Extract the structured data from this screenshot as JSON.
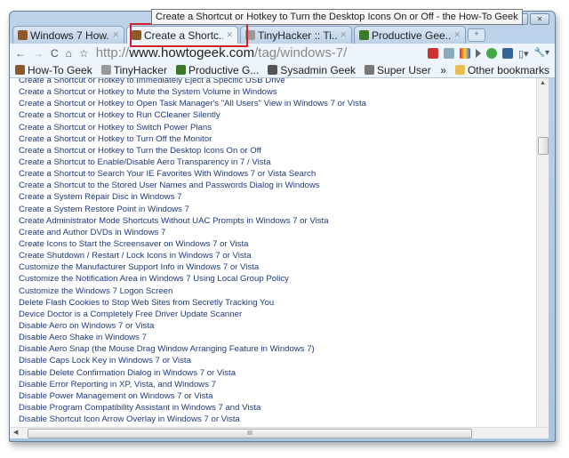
{
  "tooltip": "Create a Shortcut or Hotkey to Turn the Desktop Icons On or Off - the How-To Geek",
  "tabs": [
    {
      "label": "Windows 7 How...",
      "color": "#8a5a2a"
    },
    {
      "label": "Create a Shortc...",
      "color": "#8a5a2a"
    },
    {
      "label": "TinyHacker :: Ti...",
      "color": "#999999"
    },
    {
      "label": "Productive Gee...",
      "color": "#3a7a2a"
    }
  ],
  "toolbar": {
    "back": "←",
    "forward": "→",
    "reload": "C",
    "home": "⌂",
    "star": "☆",
    "url_prefix": "http://",
    "url_host": "www.howtogeek.com",
    "url_path": "/tag/windows-7/",
    "page_menu": "▯▾",
    "wrench": "🔧▾"
  },
  "bookmarks": [
    {
      "label": "How-To Geek",
      "color": "#8a5a2a"
    },
    {
      "label": "TinyHacker",
      "color": "#999999"
    },
    {
      "label": "Productive G...",
      "color": "#3a7a2a"
    },
    {
      "label": "Sysadmin Geek",
      "color": "#555555"
    },
    {
      "label": "Super User",
      "color": "#777777"
    }
  ],
  "bookmarks_more": "»",
  "other_bookmarks": "Other bookmarks",
  "links": [
    "Create a Shortcut or Hotkey to Immediately Eject a Specific USB Drive",
    "Create a Shortcut or Hotkey to Mute the System Volume in Windows",
    "Create a Shortcut or Hotkey to Open Task Manager's \"All Users\" View in Windows 7 or Vista",
    "Create a Shortcut or Hotkey to Run CCleaner Silently",
    "Create a Shortcut or Hotkey to Switch Power Plans",
    "Create a Shortcut or Hotkey to Turn Off the Monitor",
    "Create a Shortcut or Hotkey to Turn the Desktop Icons On or Off",
    "Create a Shortcut to Enable/Disable Aero Transparency in 7 / Vista",
    "Create a Shortcut to Search Your IE Favorites With Windows 7 or Vista Search",
    "Create a Shortcut to the Stored User Names and Passwords Dialog in Windows",
    "Create a System Repair Disc in Windows 7",
    "Create a System Restore Point in Windows 7",
    "Create Administrator Mode Shortcuts Without UAC Prompts in Windows 7 or Vista",
    "Create and Author DVDs in Windows 7",
    "Create Icons to Start the Screensaver on Windows 7 or Vista",
    "Create Shutdown / Restart / Lock Icons in Windows 7 or Vista",
    "Customize the Manufacturer Support Info in Windows 7 or Vista",
    "Customize the Notification Area in Windows 7 Using Local Group Policy",
    "Customize the Windows 7 Logon Screen",
    "Delete Flash Cookies to Stop Web Sites from Secretly Tracking You",
    "Device Doctor is a Completely Free Driver Update Scanner",
    "Disable Aero on Windows 7 or Vista",
    "Disable Aero Shake in Windows 7",
    "Disable Aero Snap (the Mouse Drag Window Arranging Feature in Windows 7)",
    "Disable Caps Lock Key in Windows 7 or Vista",
    "Disable Delete Confirmation Dialog in Windows 7 or Vista",
    "Disable Error Reporting in XP, Vista, and Windows 7",
    "Disable Power Management on Windows 7 or Vista",
    "Disable Program Compatibility Assistant in Windows 7 and Vista",
    "Disable Shortcut Icon Arrow Overlay in Windows 7 or Vista"
  ]
}
